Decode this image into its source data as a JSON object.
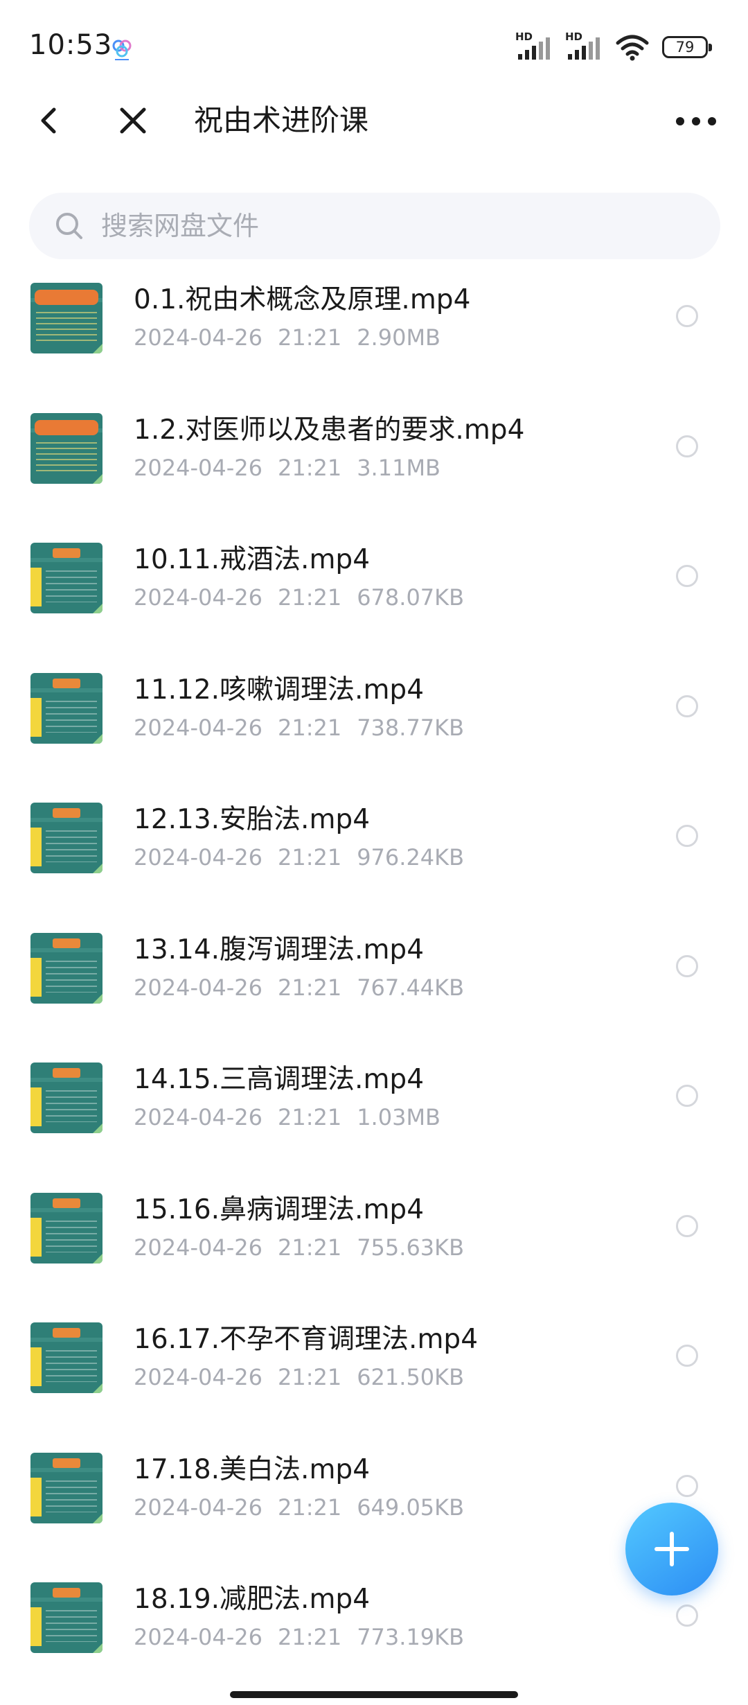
{
  "status_bar": {
    "time": "10:53",
    "network_1": "HD",
    "network_2": "HD",
    "battery": "79"
  },
  "header": {
    "title": "祝由术进阶课",
    "back_icon": "back-arrow-icon",
    "close_icon": "close-icon",
    "more_icon": "more-dots-icon"
  },
  "search": {
    "placeholder": "搜索网盘文件",
    "value": ""
  },
  "files": [
    {
      "name": "0.1.祝由术概念及原理.mp4",
      "date": "2024-04-26",
      "time": "21:21",
      "size": "2.90MB"
    },
    {
      "name": "1.2.对医师以及患者的要求.mp4",
      "date": "2024-04-26",
      "time": "21:21",
      "size": "3.11MB"
    },
    {
      "name": "10.11.戒酒法.mp4",
      "date": "2024-04-26",
      "time": "21:21",
      "size": "678.07KB"
    },
    {
      "name": "11.12.咳嗽调理法.mp4",
      "date": "2024-04-26",
      "time": "21:21",
      "size": "738.77KB"
    },
    {
      "name": "12.13.安胎法.mp4",
      "date": "2024-04-26",
      "time": "21:21",
      "size": "976.24KB"
    },
    {
      "name": "13.14.腹泻调理法.mp4",
      "date": "2024-04-26",
      "time": "21:21",
      "size": "767.44KB"
    },
    {
      "name": "14.15.三高调理法.mp4",
      "date": "2024-04-26",
      "time": "21:21",
      "size": "1.03MB"
    },
    {
      "name": "15.16.鼻病调理法.mp4",
      "date": "2024-04-26",
      "time": "21:21",
      "size": "755.63KB"
    },
    {
      "name": "16.17.不孕不育调理法.mp4",
      "date": "2024-04-26",
      "time": "21:21",
      "size": "621.50KB"
    },
    {
      "name": "17.18.美白法.mp4",
      "date": "2024-04-26",
      "time": "21:21",
      "size": "649.05KB"
    },
    {
      "name": "18.19.减肥法.mp4",
      "date": "2024-04-26",
      "time": "21:21",
      "size": "773.19KB"
    }
  ],
  "fab": {
    "icon": "plus-icon"
  },
  "colors": {
    "accent": "#2c8df4",
    "meta_text": "#a8abb3",
    "search_bg": "#f5f6fa",
    "thumb_bg": "#2f7f77"
  }
}
